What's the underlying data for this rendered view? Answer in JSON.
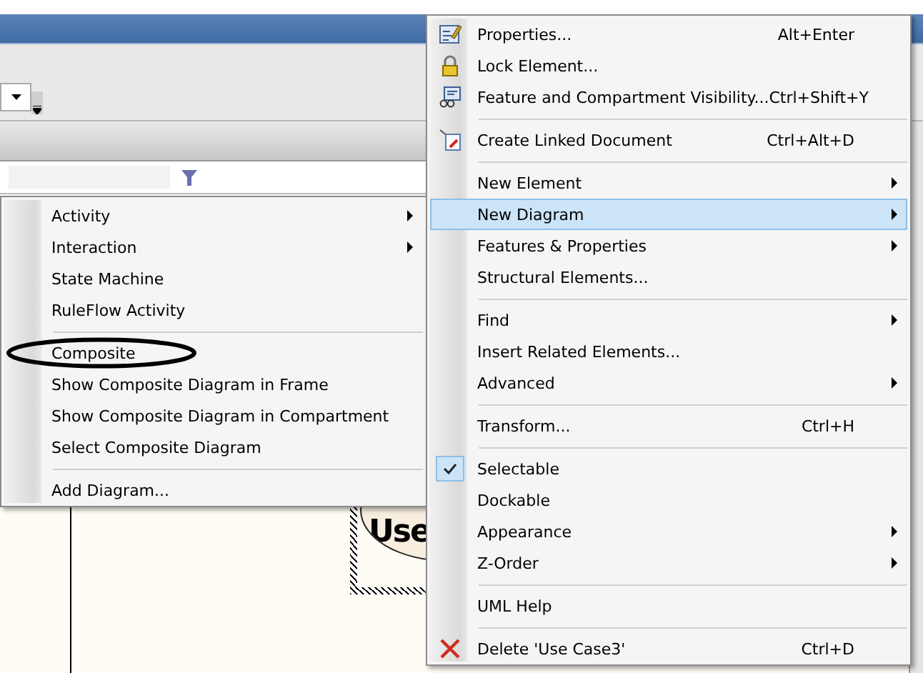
{
  "diagram": {
    "element_label": "Use"
  },
  "submenu": {
    "items": [
      {
        "kind": "item",
        "label": "Activity",
        "submenu": true,
        "selected": false
      },
      {
        "kind": "item",
        "label": "Interaction",
        "submenu": true,
        "selected": false
      },
      {
        "kind": "item",
        "label": "State Machine",
        "submenu": false,
        "selected": false
      },
      {
        "kind": "item",
        "label": "RuleFlow Activity",
        "submenu": false,
        "selected": false
      },
      {
        "kind": "separator"
      },
      {
        "kind": "item",
        "label": "Composite",
        "submenu": false,
        "selected": false,
        "circled": true
      },
      {
        "kind": "item",
        "label": "Show Composite Diagram in Frame",
        "submenu": false,
        "selected": false
      },
      {
        "kind": "item",
        "label": "Show Composite Diagram in Compartment",
        "submenu": false,
        "selected": false
      },
      {
        "kind": "item",
        "label": "Select Composite Diagram",
        "submenu": false,
        "selected": false
      },
      {
        "kind": "separator"
      },
      {
        "kind": "item",
        "label": "Add Diagram...",
        "submenu": false,
        "selected": false
      }
    ]
  },
  "context_menu": {
    "items": [
      {
        "kind": "item",
        "label": "Properties...",
        "shortcut": "Alt+Enter",
        "submenu": false,
        "selected": false
      },
      {
        "kind": "item",
        "label": "Lock Element...",
        "submenu": false,
        "selected": false
      },
      {
        "kind": "item",
        "label": "Feature and Compartment Visibility...",
        "shortcut": "Ctrl+Shift+Y",
        "submenu": false,
        "selected": false
      },
      {
        "kind": "separator"
      },
      {
        "kind": "item",
        "label": "Create Linked Document",
        "shortcut": "Ctrl+Alt+D",
        "submenu": false,
        "selected": false
      },
      {
        "kind": "separator"
      },
      {
        "kind": "item",
        "label": "New Element",
        "submenu": true,
        "selected": false
      },
      {
        "kind": "item",
        "label": "New Diagram",
        "submenu": true,
        "selected": true
      },
      {
        "kind": "item",
        "label": "Features & Properties",
        "submenu": true,
        "selected": false
      },
      {
        "kind": "item",
        "label": "Structural Elements...",
        "submenu": false,
        "selected": false
      },
      {
        "kind": "separator"
      },
      {
        "kind": "item",
        "label": "Find",
        "submenu": true,
        "selected": false
      },
      {
        "kind": "item",
        "label": "Insert Related Elements...",
        "submenu": false,
        "selected": false
      },
      {
        "kind": "item",
        "label": "Advanced",
        "submenu": true,
        "selected": false
      },
      {
        "kind": "separator"
      },
      {
        "kind": "item",
        "label": "Transform...",
        "shortcut": "Ctrl+H",
        "submenu": false,
        "selected": false
      },
      {
        "kind": "separator"
      },
      {
        "kind": "item",
        "label": "Selectable",
        "submenu": false,
        "selected": false,
        "checked": true
      },
      {
        "kind": "item",
        "label": "Dockable",
        "submenu": false,
        "selected": false,
        "checked": false
      },
      {
        "kind": "item",
        "label": "Appearance",
        "submenu": true,
        "selected": false
      },
      {
        "kind": "item",
        "label": "Z-Order",
        "submenu": true,
        "selected": false
      },
      {
        "kind": "separator"
      },
      {
        "kind": "item",
        "label": "UML Help",
        "submenu": false,
        "selected": false
      },
      {
        "kind": "separator"
      },
      {
        "kind": "item",
        "label": "Delete 'Use Case3'",
        "shortcut": "Ctrl+D",
        "submenu": false,
        "selected": false
      }
    ]
  }
}
